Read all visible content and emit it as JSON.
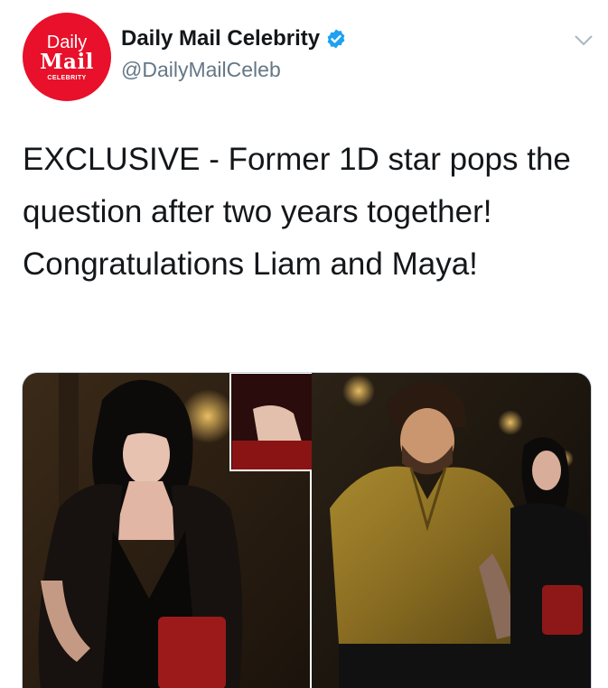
{
  "account": {
    "avatar_line1": "Daily",
    "avatar_line2": "Mail",
    "avatar_line3": "CELEBRITY",
    "display_name": "Daily Mail Celebrity",
    "handle": "@DailyMailCeleb",
    "verified": true
  },
  "tweet": {
    "text": "EXCLUSIVE - Former 1D star pops the question after two years together! Congratulations Liam and Maya!"
  },
  "colors": {
    "brand_red": "#e8102a",
    "verified_blue": "#1da1f2",
    "handle_gray": "#657786"
  },
  "icons": {
    "verified": "verified-badge-icon",
    "menu": "chevron-down-icon"
  }
}
